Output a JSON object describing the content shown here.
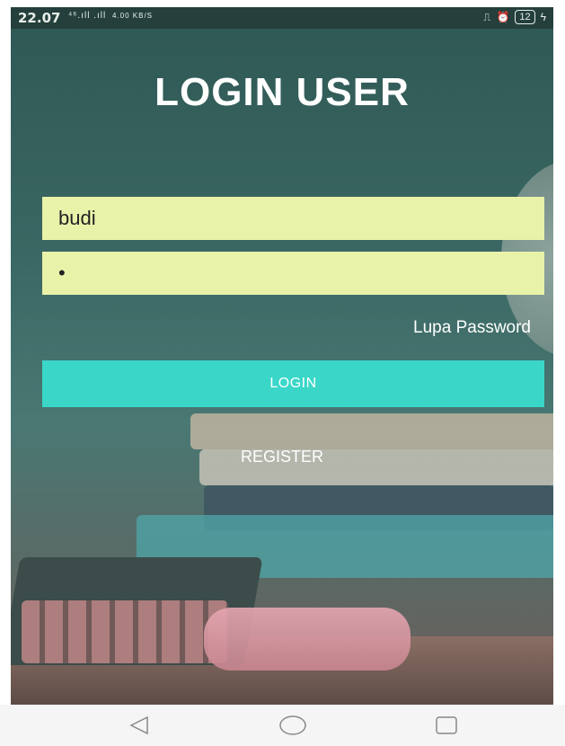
{
  "status_bar": {
    "time": "22.07",
    "signal": "⁴⁶.ıll .ıll",
    "net_speed": "4.00 KB/S",
    "battery": "12"
  },
  "login": {
    "title": "LOGIN USER",
    "username_value": "budi",
    "password_value": "•",
    "forgot_label": "Lupa Password",
    "login_label": "LOGIN",
    "register_label": "REGISTER"
  },
  "colors": {
    "input_bg": "#e9f2a9",
    "login_button": "#3ad7c9",
    "background": "#35605c"
  },
  "nav": {
    "icons": [
      "back-icon",
      "home-icon",
      "recents-icon"
    ]
  }
}
